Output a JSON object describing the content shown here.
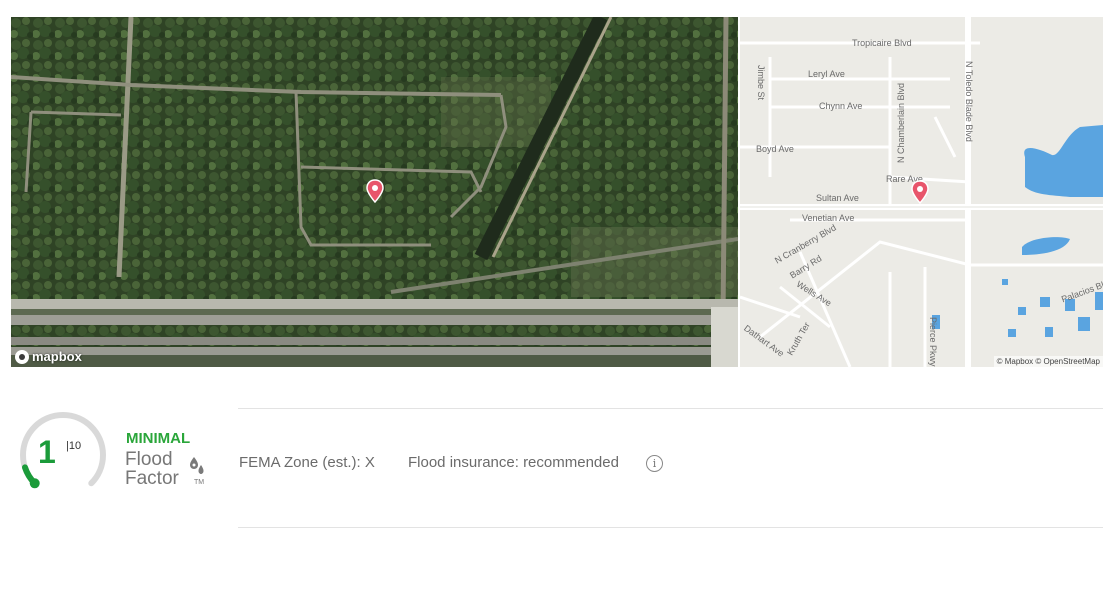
{
  "satellite_map": {
    "logo_text": "mapbox"
  },
  "street_map": {
    "streets": [
      "Tropicaire Blvd",
      "Jimbe St",
      "Leryl Ave",
      "Chynn Ave",
      "N Toledo Blade Blvd",
      "N Chamberlain Blvd",
      "Boyd Ave",
      "Rare Ave",
      "Sultan Ave",
      "Venetian Ave",
      "N Cranberry Blvd",
      "Barry Rd",
      "Wells Ave",
      "Dathart Ave",
      "Kruth Ter",
      "Pierce Pkwy",
      "Palacios Blvd"
    ],
    "attribution": "© Mapbox © OpenStreetMap"
  },
  "flood_factor": {
    "score": "1",
    "max": "|10",
    "level": "MINIMAL",
    "brand_line1": "Flood",
    "brand_line2": "Factor",
    "tm": "TM",
    "score_fraction": 0.1,
    "color": "#2aa63a"
  },
  "details": {
    "fema_zone": "FEMA Zone (est.): X",
    "insurance": "Flood insurance: recommended",
    "info_icon": "i"
  }
}
